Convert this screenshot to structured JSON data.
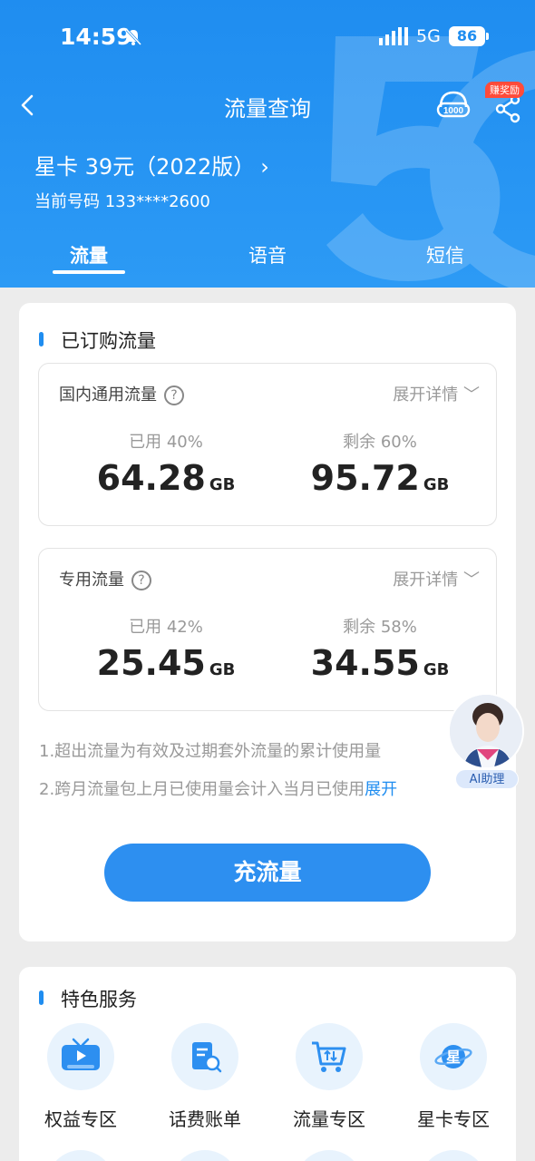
{
  "status_bar": {
    "time": "14:59",
    "network": "5G",
    "battery": "86"
  },
  "nav": {
    "title": "流量查询",
    "reward_badge": "赚奖励"
  },
  "plan": {
    "name": "星卡 39元（2022版）",
    "phone": "当前号码 133****2600"
  },
  "tabs": [
    {
      "label": "流量"
    },
    {
      "label": "语音"
    },
    {
      "label": "短信"
    }
  ],
  "subscribed": {
    "title": "已订购流量",
    "domestic": {
      "title": "国内通用流量",
      "expand": "展开详情",
      "used_label": "已用 40%",
      "used_value": "64.28",
      "remaining_label": "剩余 60%",
      "remaining_value": "95.72",
      "unit": "GB"
    },
    "dedicated": {
      "title": "专用流量",
      "expand": "展开详情",
      "used_label": "已用 42%",
      "used_value": "25.45",
      "remaining_label": "剩余 58%",
      "remaining_value": "34.55",
      "unit": "GB"
    },
    "notes": [
      "1.超出流量为有效及过期套外流量的累计使用量",
      "2.跨月流量包上月已使用量会计入当月已使用"
    ],
    "notes_expand": "展开",
    "recharge_label": "充流量"
  },
  "ai_assistant": {
    "label": "AI助理"
  },
  "featured": {
    "title": "特色服务",
    "items": [
      {
        "label": "权益专区",
        "icon": "tv-icon"
      },
      {
        "label": "话费账单",
        "icon": "bill-icon"
      },
      {
        "label": "流量专区",
        "icon": "cart-icon"
      },
      {
        "label": "星卡专区",
        "icon": "planet-icon"
      }
    ]
  },
  "colors": {
    "brand": "#1f8df0",
    "button": "#2d8ff0",
    "badge": "#ff4b3a"
  }
}
